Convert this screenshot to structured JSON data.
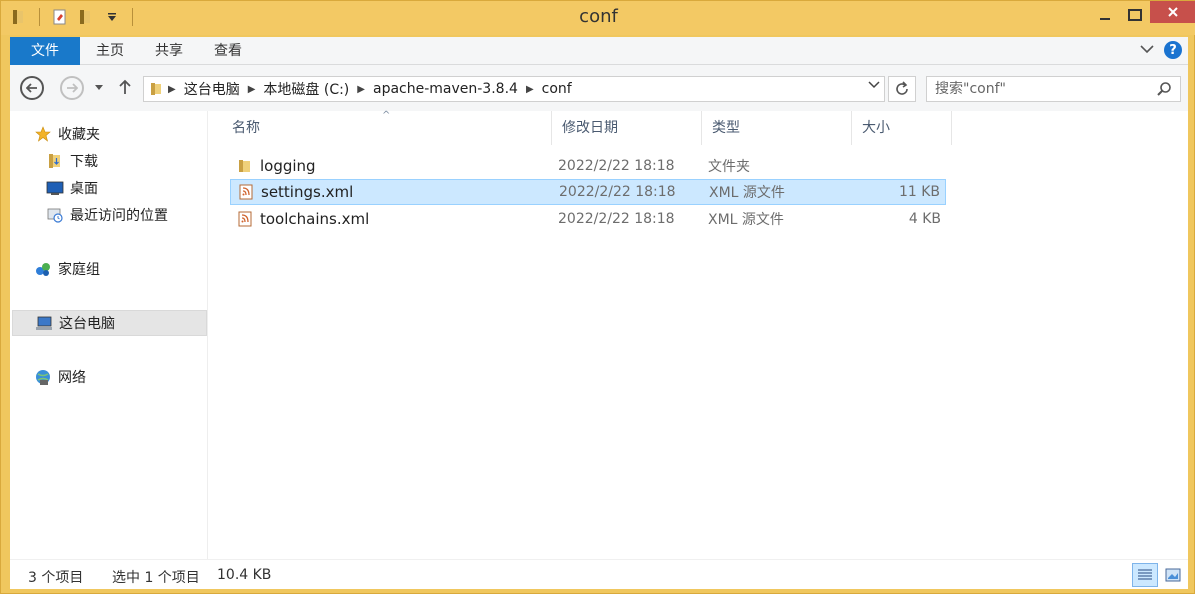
{
  "window": {
    "title": "conf"
  },
  "ribbon": {
    "tabs": [
      {
        "label": "文件"
      },
      {
        "label": "主页"
      },
      {
        "label": "共享"
      },
      {
        "label": "查看"
      }
    ]
  },
  "address": {
    "crumbs": [
      "这台电脑",
      "本地磁盘 (C:)",
      "apache-maven-3.8.4",
      "conf"
    ]
  },
  "search": {
    "placeholder": "搜索\"conf\""
  },
  "sidebar": {
    "items": [
      {
        "label": "收藏夹",
        "icon": "star-icon"
      },
      {
        "label": "下载",
        "icon": "download-folder-icon"
      },
      {
        "label": "桌面",
        "icon": "desktop-icon"
      },
      {
        "label": "最近访问的位置",
        "icon": "recent-places-icon"
      },
      {
        "label": "家庭组",
        "icon": "homegroup-icon"
      },
      {
        "label": "这台电脑",
        "icon": "computer-icon"
      },
      {
        "label": "网络",
        "icon": "network-icon"
      }
    ]
  },
  "filelist": {
    "columns": [
      "名称",
      "修改日期",
      "类型",
      "大小"
    ],
    "rows": [
      {
        "name": "logging",
        "date": "2022/2/22 18:18",
        "type": "文件夹",
        "size": "",
        "icon": "folder-icon"
      },
      {
        "name": "settings.xml",
        "date": "2022/2/22 18:18",
        "type": "XML 源文件",
        "size": "11 KB",
        "icon": "xml-file-icon"
      },
      {
        "name": "toolchains.xml",
        "date": "2022/2/22 18:18",
        "type": "XML 源文件",
        "size": "4 KB",
        "icon": "xml-file-icon"
      }
    ]
  },
  "status": {
    "count": "3 个项目",
    "selection": "选中 1 个项目",
    "size": "10.4 KB"
  },
  "colors": {
    "title_bar": "#f3c964",
    "file_tab": "#1979ca",
    "selection": "#cce8ff",
    "close_button": "#c7504b"
  }
}
